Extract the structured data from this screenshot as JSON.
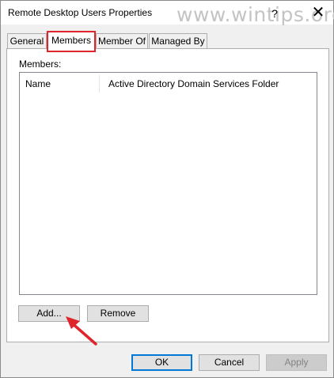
{
  "window": {
    "title": "Remote Desktop Users Properties",
    "help_glyph": "?",
    "close_glyph": "✕",
    "watermark": "www.wintips.org"
  },
  "tabs": [
    {
      "label": "General",
      "selected": false
    },
    {
      "label": "Members",
      "selected": true
    },
    {
      "label": "Member Of",
      "selected": false
    },
    {
      "label": "Managed By",
      "selected": false
    }
  ],
  "members": {
    "label": "Members:",
    "columns": [
      "Name",
      "Active Directory Domain Services Folder"
    ],
    "rows": []
  },
  "buttons": {
    "add": "Add...",
    "remove": "Remove",
    "ok": "OK",
    "cancel": "Cancel",
    "apply": "Apply"
  },
  "colors": {
    "highlight": "#e0262d",
    "arrow": "#e0262d"
  }
}
